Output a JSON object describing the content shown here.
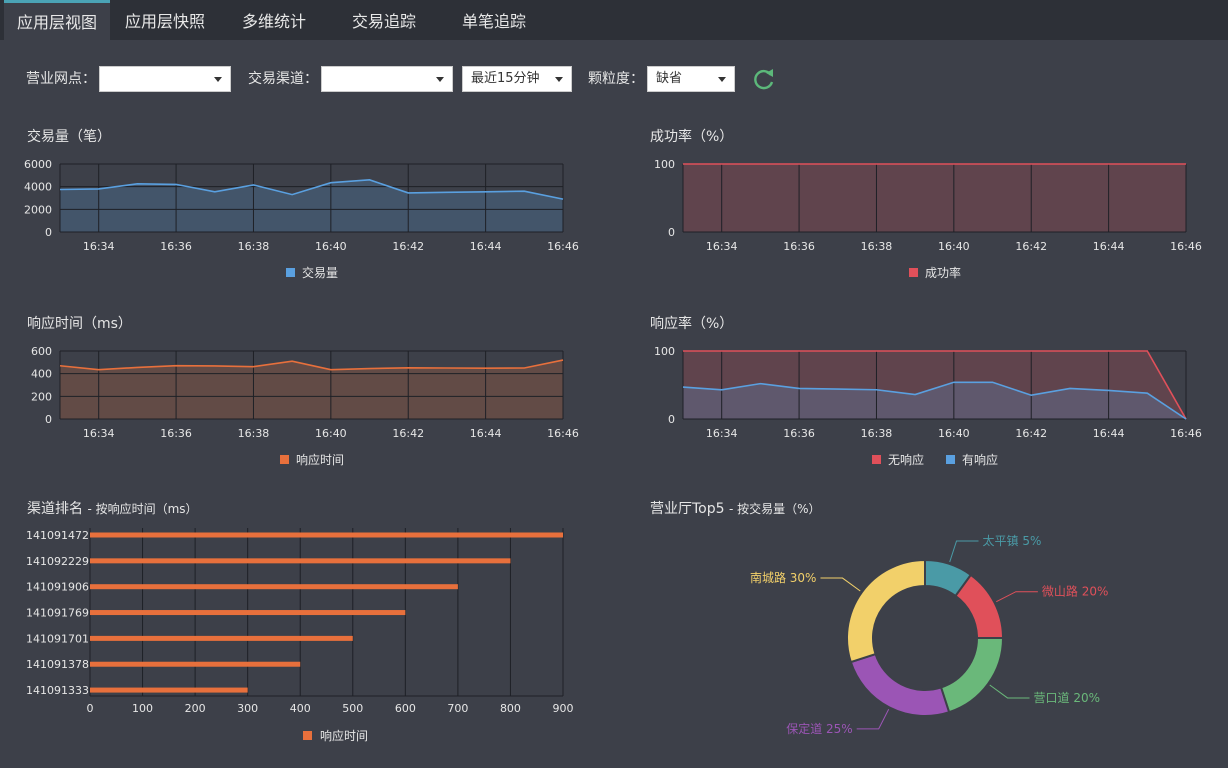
{
  "tabs": [
    {
      "label": "应用层视图",
      "active": true
    },
    {
      "label": "应用层快照",
      "active": false
    },
    {
      "label": "多维统计",
      "active": false
    },
    {
      "label": "交易追踪",
      "active": false
    },
    {
      "label": "单笔追踪",
      "active": false
    }
  ],
  "filters": {
    "branch_label": "营业网点：",
    "branch_value": "",
    "channel_label": "交易渠道：",
    "channel_value": "",
    "period_value": "最近15分钟",
    "granularity_label": "颗粒度：",
    "granularity_value": "缺省"
  },
  "colors": {
    "blue": "#5aa0e0",
    "red": "#e0505a",
    "orange": "#e8703c",
    "teal": "#4a9aa6",
    "green": "#6ab87a",
    "purple": "#9b55b5",
    "yellow": "#f2d06a"
  },
  "chart_data": [
    {
      "id": "volume",
      "type": "area",
      "title": "交易量（笔）",
      "x": [
        "16:33",
        "16:34",
        "16:35",
        "16:36",
        "16:37",
        "16:38",
        "16:39",
        "16:40",
        "16:41",
        "16:42",
        "16:43",
        "16:44",
        "16:45",
        "16:46"
      ],
      "xticks": [
        "16:34",
        "16:36",
        "16:38",
        "16:40",
        "16:42",
        "16:44",
        "16:46"
      ],
      "yticks": [
        0,
        2000,
        4000,
        6000
      ],
      "ylim": [
        0,
        6000
      ],
      "series": [
        {
          "name": "交易量",
          "color": "#5aa0e0",
          "values": [
            3750,
            3800,
            4250,
            4200,
            3550,
            4150,
            3300,
            4350,
            4600,
            3450,
            3500,
            3550,
            3600,
            2900
          ]
        }
      ]
    },
    {
      "id": "success",
      "type": "area",
      "title": "成功率（%）",
      "x": [
        "16:33",
        "16:34",
        "16:35",
        "16:36",
        "16:37",
        "16:38",
        "16:39",
        "16:40",
        "16:41",
        "16:42",
        "16:43",
        "16:44",
        "16:45",
        "16:46"
      ],
      "xticks": [
        "16:34",
        "16:36",
        "16:38",
        "16:40",
        "16:42",
        "16:44",
        "16:46"
      ],
      "yticks": [
        0,
        100
      ],
      "ylim": [
        0,
        100
      ],
      "series": [
        {
          "name": "成功率",
          "color": "#e0505a",
          "values": [
            100,
            100,
            100,
            100,
            100,
            100,
            100,
            100,
            100,
            100,
            100,
            100,
            100,
            100
          ]
        }
      ]
    },
    {
      "id": "resp_time",
      "type": "area",
      "title": "响应时间（ms）",
      "x": [
        "16:33",
        "16:34",
        "16:35",
        "16:36",
        "16:37",
        "16:38",
        "16:39",
        "16:40",
        "16:41",
        "16:42",
        "16:43",
        "16:44",
        "16:45",
        "16:46"
      ],
      "xticks": [
        "16:34",
        "16:36",
        "16:38",
        "16:40",
        "16:42",
        "16:44",
        "16:46"
      ],
      "yticks": [
        0,
        200,
        400,
        600
      ],
      "ylim": [
        0,
        600
      ],
      "series": [
        {
          "name": "响应时间",
          "color": "#e8703c",
          "values": [
            470,
            435,
            455,
            470,
            468,
            462,
            510,
            435,
            445,
            452,
            450,
            448,
            450,
            520
          ]
        }
      ]
    },
    {
      "id": "resp_rate",
      "type": "area",
      "title": "响应率（%）",
      "x": [
        "16:33",
        "16:34",
        "16:35",
        "16:36",
        "16:37",
        "16:38",
        "16:39",
        "16:40",
        "16:41",
        "16:42",
        "16:43",
        "16:44",
        "16:45",
        "16:46"
      ],
      "xticks": [
        "16:34",
        "16:36",
        "16:38",
        "16:40",
        "16:42",
        "16:44",
        "16:46"
      ],
      "yticks": [
        0,
        100
      ],
      "ylim": [
        0,
        100
      ],
      "series": [
        {
          "name": "无响应",
          "color": "#e0505a",
          "values": [
            100,
            100,
            100,
            100,
            100,
            100,
            100,
            100,
            100,
            100,
            100,
            100,
            100,
            0
          ]
        },
        {
          "name": "有响应",
          "color": "#5aa0e0",
          "values": [
            47,
            43,
            52,
            45,
            44,
            43,
            36,
            54,
            54,
            35,
            45,
            42,
            38,
            0
          ]
        }
      ]
    },
    {
      "id": "channel_rank",
      "type": "bar",
      "title": "渠道排名",
      "subtitle": "- 按响应时间（ms）",
      "categories": [
        "141091472",
        "141092229",
        "141091906",
        "141091769",
        "141091701",
        "141091378",
        "141091333"
      ],
      "xticks": [
        0,
        100,
        200,
        300,
        400,
        500,
        600,
        700,
        800,
        900
      ],
      "xlim": [
        0,
        900
      ],
      "series": [
        {
          "name": "响应时间",
          "color": "#e8703c",
          "values": [
            900,
            800,
            700,
            600,
            500,
            400,
            300
          ]
        }
      ]
    },
    {
      "id": "top5",
      "type": "pie",
      "title": "营业厅Top5",
      "subtitle": "- 按交易量（%）",
      "slices": [
        {
          "label": "太平镇 5%",
          "value": 10,
          "color": "#4a9aa6"
        },
        {
          "label": "微山路 20%",
          "value": 15,
          "color": "#e0505a"
        },
        {
          "label": "营口道 20%",
          "value": 20,
          "color": "#6ab87a"
        },
        {
          "label": "保定道 25%",
          "value": 25,
          "color": "#9b55b5"
        },
        {
          "label": "南城路 30%",
          "value": 30,
          "color": "#f2d06a"
        }
      ]
    }
  ]
}
